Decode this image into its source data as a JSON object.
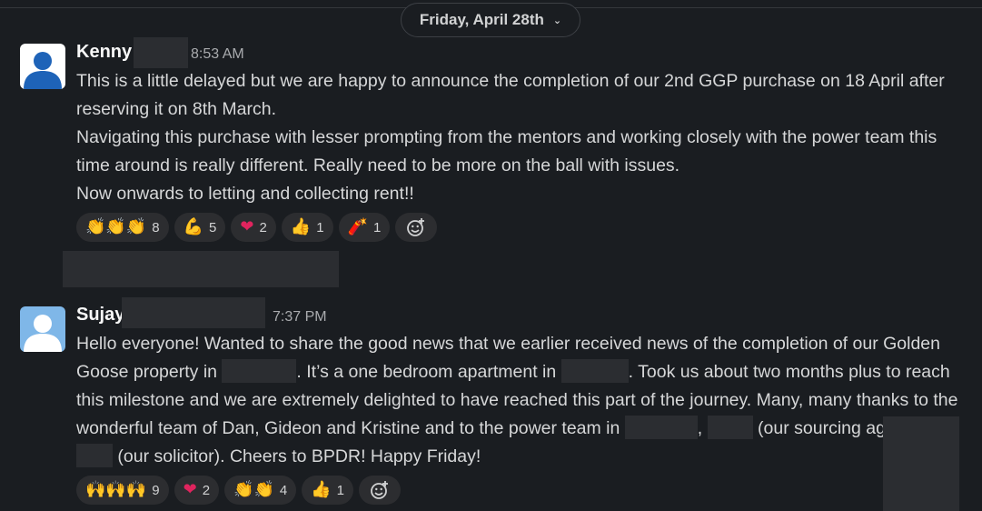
{
  "date_divider": {
    "label": "Friday, April 28th"
  },
  "messages": [
    {
      "author": "Kenny",
      "time": "8:53 AM",
      "paragraphs": [
        "This is a little delayed but we are happy to announce the completion of our 2nd GGP purchase on 18 April after reserving it on 8th March.",
        "Navigating this purchase with lesser prompting from the mentors and working closely with the power team this time around is really different. Really need to be more on the ball with issues.",
        "Now onwards to letting and collecting rent!!"
      ],
      "reactions": [
        {
          "emoji": "👏👏👏",
          "count": "8"
        },
        {
          "emoji": "💪",
          "count": "5"
        },
        {
          "emoji": "❤",
          "count": "2"
        },
        {
          "emoji": "👍",
          "count": "1"
        },
        {
          "emoji": "🧨",
          "count": "1"
        }
      ]
    },
    {
      "author": "Sujay",
      "time": "7:37 PM",
      "text": {
        "s1": "Hello everyone! Wanted to share the good news that we earlier received news of the completion of our Golden Goose property in ",
        "s2": ". It’s a one bedroom apartment in ",
        "s3": ". Took us about two months plus to reach this milestone and we are extremely delighted to have reached this part of the journey. Many, many thanks to the wonderful team of Dan, Gideon and Kristine and to the power team in ",
        "s4": ", ",
        "s5": " (our sourcing agent) & ",
        "s6": " (our solicitor). Cheers to BPDR! Happy Friday!"
      },
      "reactions": [
        {
          "emoji": "🙌🙌🙌",
          "count": "9"
        },
        {
          "emoji": "❤",
          "count": "2"
        },
        {
          "emoji": "👏👏",
          "count": "4"
        },
        {
          "emoji": "👍",
          "count": "1"
        }
      ]
    }
  ],
  "colors": {
    "background": "#1a1d21",
    "avatar_blue_1": "#1e63b8",
    "avatar_blue_2": "#7fb7e8",
    "reaction_bg": "#2c2d30"
  }
}
